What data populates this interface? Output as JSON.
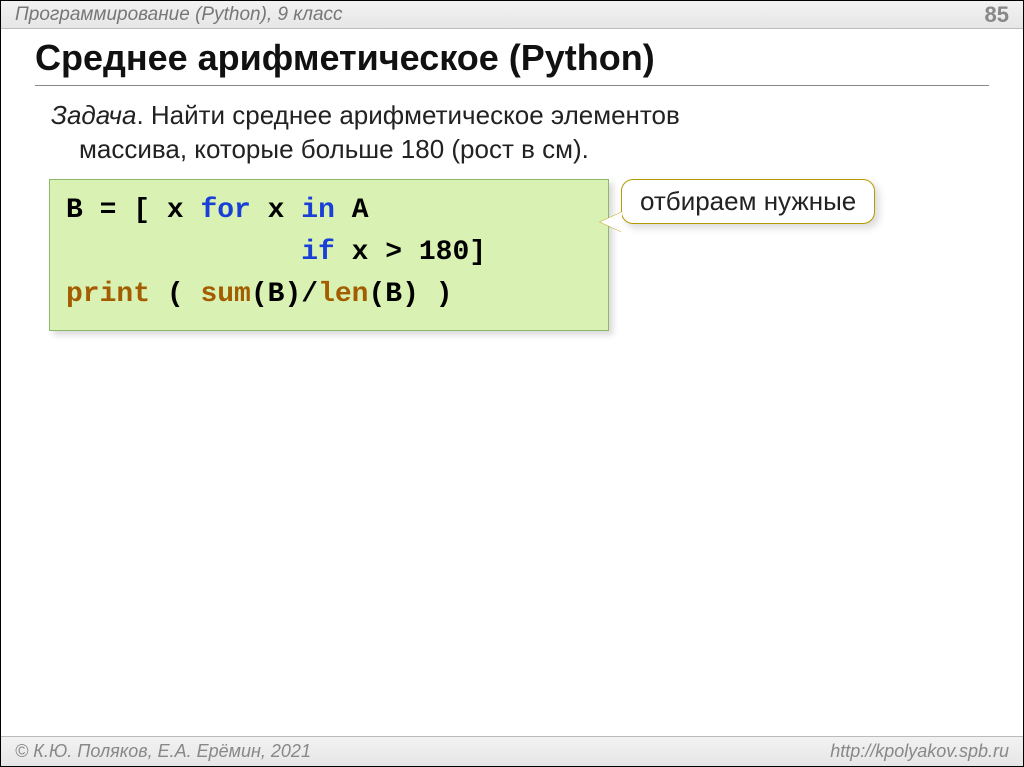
{
  "header": {
    "left": "Программирование (Python), 9 класс",
    "pageNumber": "85"
  },
  "title": "Среднее арифметическое (Python)",
  "task": {
    "label": "Задача",
    "line1_rest": ". Найти среднее арифметическое элементов",
    "line2": "массива, которые больше 180 (рост в см)."
  },
  "code": {
    "t1": "B",
    "t2": " = [ x ",
    "kw_for": "for",
    "t3": " x ",
    "kw_in": "in",
    "t4": " A",
    "line2_indent": "              ",
    "kw_if": "if",
    "t5": " x > 180]",
    "kw_print": "print",
    "t6": " ( ",
    "kw_sum": "sum",
    "t7": "(B)/",
    "kw_len": "len",
    "t8": "(B) )"
  },
  "callout": "отбираем нужные",
  "footer": {
    "left": "© К.Ю. Поляков, Е.А. Ерёмин, 2021",
    "right": "http://kpolyakov.spb.ru"
  }
}
